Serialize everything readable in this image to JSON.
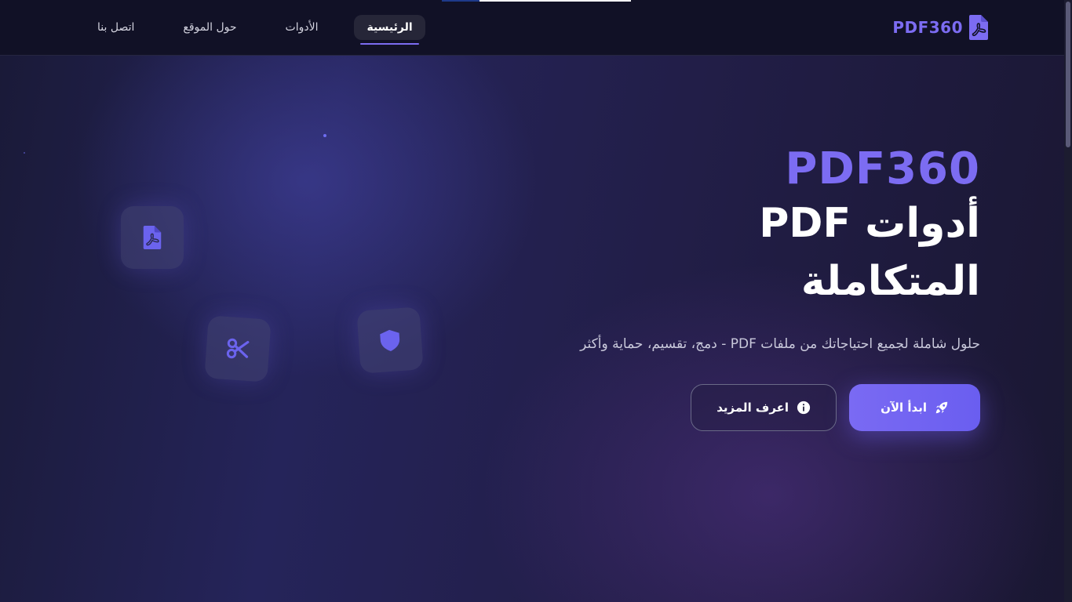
{
  "header": {
    "brand": "PDF360",
    "nav": [
      {
        "label": "الرئيسية",
        "active": true
      },
      {
        "label": "الأدوات",
        "active": false
      },
      {
        "label": "حول الموقع",
        "active": false
      },
      {
        "label": "اتصل بنا",
        "active": false
      }
    ]
  },
  "hero": {
    "title_brand": "PDF360",
    "title_line1": "أدوات PDF",
    "title_line2": "المتكاملة",
    "subtitle": "حلول شاملة لجميع احتياجاتك من ملفات PDF - دمج، تقسيم، حماية وأكثر",
    "primary_button": "ابدأ الآن",
    "secondary_button": "اعرف المزيد"
  },
  "icons": {
    "brand": "pdf-file-icon",
    "card_pdf": "pdf-file-icon",
    "card_split": "scissors-icon",
    "card_protect": "shield-icon",
    "primary_button": "rocket-icon",
    "secondary_button": "info-icon"
  },
  "colors": {
    "accent": "#7c6cf2",
    "background": "#14142a",
    "header": "#111126",
    "text": "#ffffff"
  }
}
